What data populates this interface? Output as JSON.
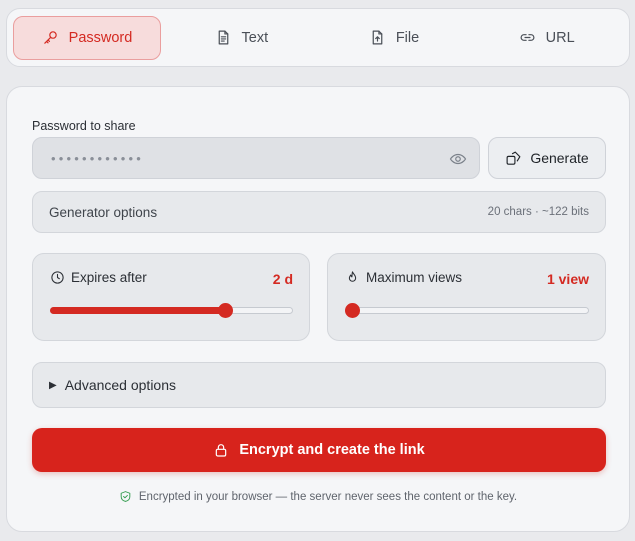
{
  "tabs": [
    {
      "label": "Password",
      "icon": "key-icon",
      "active": true
    },
    {
      "label": "Text",
      "icon": "document-icon",
      "active": false
    },
    {
      "label": "File",
      "icon": "file-upload-icon",
      "active": false
    },
    {
      "label": "URL",
      "icon": "link-icon",
      "active": false
    }
  ],
  "password": {
    "label": "Password to share",
    "masked_value": "••••••••••••",
    "generate_label": "Generate"
  },
  "generator": {
    "label": "Generator options",
    "meta": "20 chars · ~122 bits"
  },
  "expires": {
    "label": "Expires after",
    "value": "2 d",
    "slider_fraction": 0.72
  },
  "views": {
    "label": "Maximum views",
    "value": "1 view",
    "slider_fraction": 0.0
  },
  "advanced": {
    "label": "Advanced options"
  },
  "cta": {
    "label": "Encrypt and create the link"
  },
  "note": "Encrypted in your browser — the server never sees the content or the key.",
  "colors": {
    "accent": "#d7231c",
    "active_tab_bg": "#f7dcdc",
    "shield": "#2d9a4a"
  }
}
